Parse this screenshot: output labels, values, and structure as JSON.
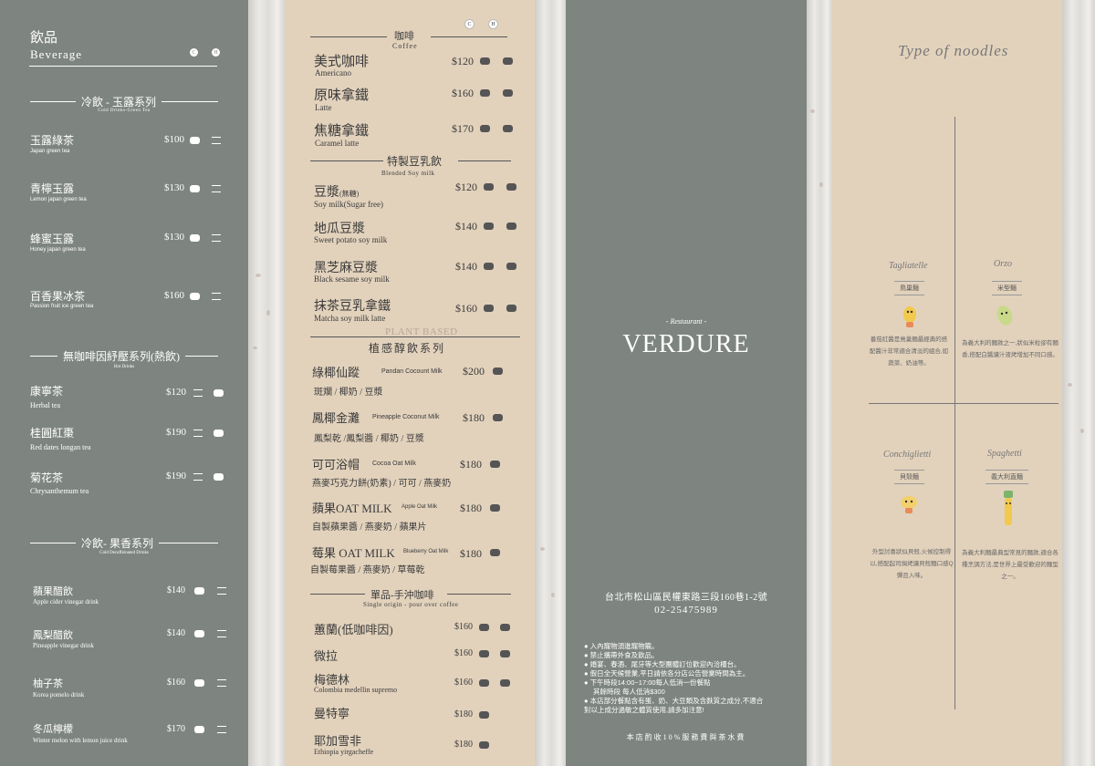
{
  "beverage": {
    "title_zh": "飲品",
    "title_en": "Beverage",
    "icon_c": "C",
    "icon_h": "H",
    "cold_green": {
      "title": "冷飲 - 玉露系列",
      "subtitle": "Cold Drinks-Green Tea",
      "items": [
        {
          "zh": "玉露綠茶",
          "en": "Japan green tea",
          "price": "$100"
        },
        {
          "zh": "青檸玉露",
          "en": "Lemon japan green tea",
          "price": "$130"
        },
        {
          "zh": "蜂蜜玉露",
          "en": "Honey japan green tea",
          "price": "$130"
        },
        {
          "zh": "百香果冰茶",
          "en": "Passion fruit ice green tea",
          "price": "$160"
        }
      ]
    },
    "hot": {
      "title": "無咖啡因紓壓系列(熱飲)",
      "subtitle": "Hot Drinks",
      "items": [
        {
          "zh": "康寧茶",
          "en": "Herbal tea",
          "price": "$120"
        },
        {
          "zh": "桂圓紅棗",
          "en": "Red dates longan tea",
          "price": "$190"
        },
        {
          "zh": "菊花茶",
          "en": "Chrysanthemum tea",
          "price": "$190"
        }
      ]
    },
    "cold_fruit": {
      "title": "冷飲- 果香系列",
      "subtitle": "Cold Decaffeinated Drinks",
      "items": [
        {
          "zh": "蘋果醋飲",
          "en": "Apple cider vinegar drink",
          "price": "$140"
        },
        {
          "zh": "鳳梨醋飲",
          "en": "Pineapple vinegar drink",
          "price": "$140"
        },
        {
          "zh": "柚子茶",
          "en": "Korea pomelo drink",
          "price": "$160"
        },
        {
          "zh": "冬瓜檸檬",
          "en": "Winter melon with lemon juice drink",
          "price": "$170"
        }
      ]
    }
  },
  "coffee": {
    "title_zh": "咖啡",
    "title_en": "Coffee",
    "items": [
      {
        "zh": "美式咖啡",
        "en": "Americano",
        "price": "$120"
      },
      {
        "zh": "原味拿鐵",
        "en": "Latte",
        "price": "$160"
      },
      {
        "zh": "焦糖拿鐵",
        "en": "Caramel latte",
        "price": "$170"
      }
    ],
    "soy": {
      "title": "特製豆乳飲",
      "subtitle": "Blended Soy milk",
      "items": [
        {
          "zh": "豆漿",
          "note": "(無糖)",
          "en": "Soy milk(Sugar free)",
          "price": "$120"
        },
        {
          "zh": "地瓜豆漿",
          "en": "Sweet potato soy milk",
          "price": "$140"
        },
        {
          "zh": "黑芝麻豆漿",
          "en": "Black sesame soy milk",
          "price": "$140"
        },
        {
          "zh": "抹茶豆乳拿鐵",
          "en": "Matcha soy milk latte",
          "price": "$160"
        }
      ]
    },
    "plant": {
      "title_en": "PLANT BASED",
      "title_zh": "植感醇飲系列",
      "items": [
        {
          "zh": "綠椰仙蹤",
          "en": "Pandan Cocount Milk",
          "price": "$200",
          "sub": "斑斕 / 椰奶 / 豆漿"
        },
        {
          "zh": "鳳椰金灘",
          "en": "Pineapple Coconut Milk",
          "price": "$180",
          "sub": "鳳梨乾 /鳳梨醬 / 椰奶 / 豆漿"
        },
        {
          "zh": "可可浴帽",
          "en": "Cocoa Oat Milk",
          "price": "$180",
          "sub": "燕麥巧克力餅(奶素) / 可可 / 燕麥奶"
        },
        {
          "zh": "蘋果OAT MILK",
          "en": "Apple Oat Milk",
          "price": "$180",
          "sub": "自製蘋果醬 / 燕麥奶 / 蘋果片"
        },
        {
          "zh": "莓果 OAT MILK",
          "en": "Blueberry Oat Milk",
          "price": "$180",
          "sub": "自製莓果醬 / 燕麥奶 / 草莓乾"
        }
      ]
    },
    "single": {
      "title": "單品-手沖咖啡",
      "subtitle": "Single origin - pour over coffee",
      "items": [
        {
          "zh": "蕙蘭(低咖啡因)",
          "en": "",
          "price": "$160"
        },
        {
          "zh": "微拉",
          "en": "",
          "price": "$160"
        },
        {
          "zh": "梅德林",
          "en": "Colombia medellin supremo",
          "price": "$160"
        },
        {
          "zh": "曼特寧",
          "en": "",
          "price": "$180"
        },
        {
          "zh": "耶加雪非",
          "en": "Ethiopia yirgacheffe",
          "price": "$180"
        }
      ]
    }
  },
  "brand": {
    "small": "- Restaurant -",
    "name": "VERDURE",
    "address": "台北市松山區民權東路三段160巷1-2號",
    "phone": "02-25475989",
    "notices": [
      "入內寵物須進寵物籠。",
      "禁止攜帶外食及飲品。",
      "婚宴、春酒、尾牙等大型團體訂位歡迎內洽櫃台。",
      "假日全天候營業,平日請依各分店公告營業時間為主。",
      "下午時段14:00~17:00每人低消一份餐點"
    ],
    "notice_extra": "其餘時段  每人低消$300",
    "notice_allergy_1": "本店部分餐點含有蛋、奶、大豆類及含麩質之成分,不適合",
    "notice_allergy_2": "對以上成分過敏之體質使用,請多加注意!",
    "service": "本店酌收10%服務費與茶水費"
  },
  "noodles": {
    "title": "Type of noodles",
    "types": [
      {
        "name_en": "Tagliatelle",
        "name_zh": "鳥巢麵",
        "desc": "番茄紅醬是鳥巢麵最經典的搭配醬汁非常適合清淡的組合,如蔬菜、奶油等。"
      },
      {
        "name_en": "Orzo",
        "name_zh": "米型麵",
        "desc": "為義大利的麵款之一,狀似米粒卻有麵香,搭配白醬讓汁液烤增加不同口感。"
      },
      {
        "name_en": "Conchiglietti",
        "name_zh": "貝殼麵",
        "desc": "外型討喜狀似貝殼,火候控制得以,搭配起司焗烤讓貝殼麵口感Q彈且入味。"
      },
      {
        "name_en": "Spaghetti",
        "name_zh": "義大利直麵",
        "desc": "為義大利麵最典型常見的麵款,適合各種烹調方法,是世界上最受歡迎的麵型之一。"
      }
    ]
  }
}
